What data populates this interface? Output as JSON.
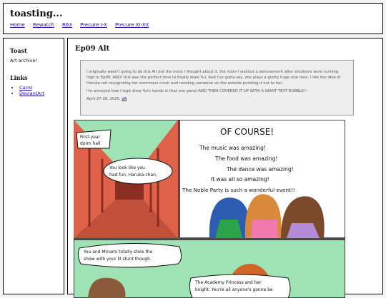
{
  "site": {
    "title": "toasting..."
  },
  "nav": [
    "Home",
    "Rewatch",
    "R63",
    "Precure I-X",
    "Precure XI-XX"
  ],
  "sidebar": {
    "heading1": "Toast",
    "text1": "Art archive!",
    "heading2": "Links",
    "links": [
      "Carrd",
      "DeviantArt"
    ]
  },
  "post": {
    "title": "Ep09 Alt",
    "p1": "I originally wasn't going to do this Alt but the more I thought about it, the more I wanted a denouement after emotions were running high in Ep09. AND! this was the perfect time to finally draw Yui. And I've gotta say, she plays a pretty huge role here. I like the idea of Haruka not recognizing her enormous crush and needing someone on the outside pointing it out to her.",
    "p2": "I'm annoyed how I legit drew Yui's hands in that one panel AND THEN COVERED IT UP WITH A GIANT TEXT BUBBLE!!",
    "date": "April 27-28, 2025,",
    "date_link": "dA"
  },
  "comic": {
    "caption1": [
      "First-year",
      "dorm hall"
    ],
    "bubble1": [
      "You look like you",
      "had fun, Haruka-chan."
    ],
    "shout": "OF COURSE!",
    "lines": [
      "The music was amazing!",
      "The food was amazing!",
      "The dance was amazing!",
      "It was all so amazing!",
      "The Noble Party is such a wonderful event!!"
    ],
    "bubble2": [
      "You and Minami totally stole the",
      "show with your lil stunt though."
    ],
    "bubble3": [
      "The Academy Princess and her",
      "knight. You're all anyone's gonna be"
    ]
  },
  "colors": {
    "link": "#1a0dab",
    "panel_green": "#9fe3b4",
    "floor_red": "#c1503a"
  }
}
